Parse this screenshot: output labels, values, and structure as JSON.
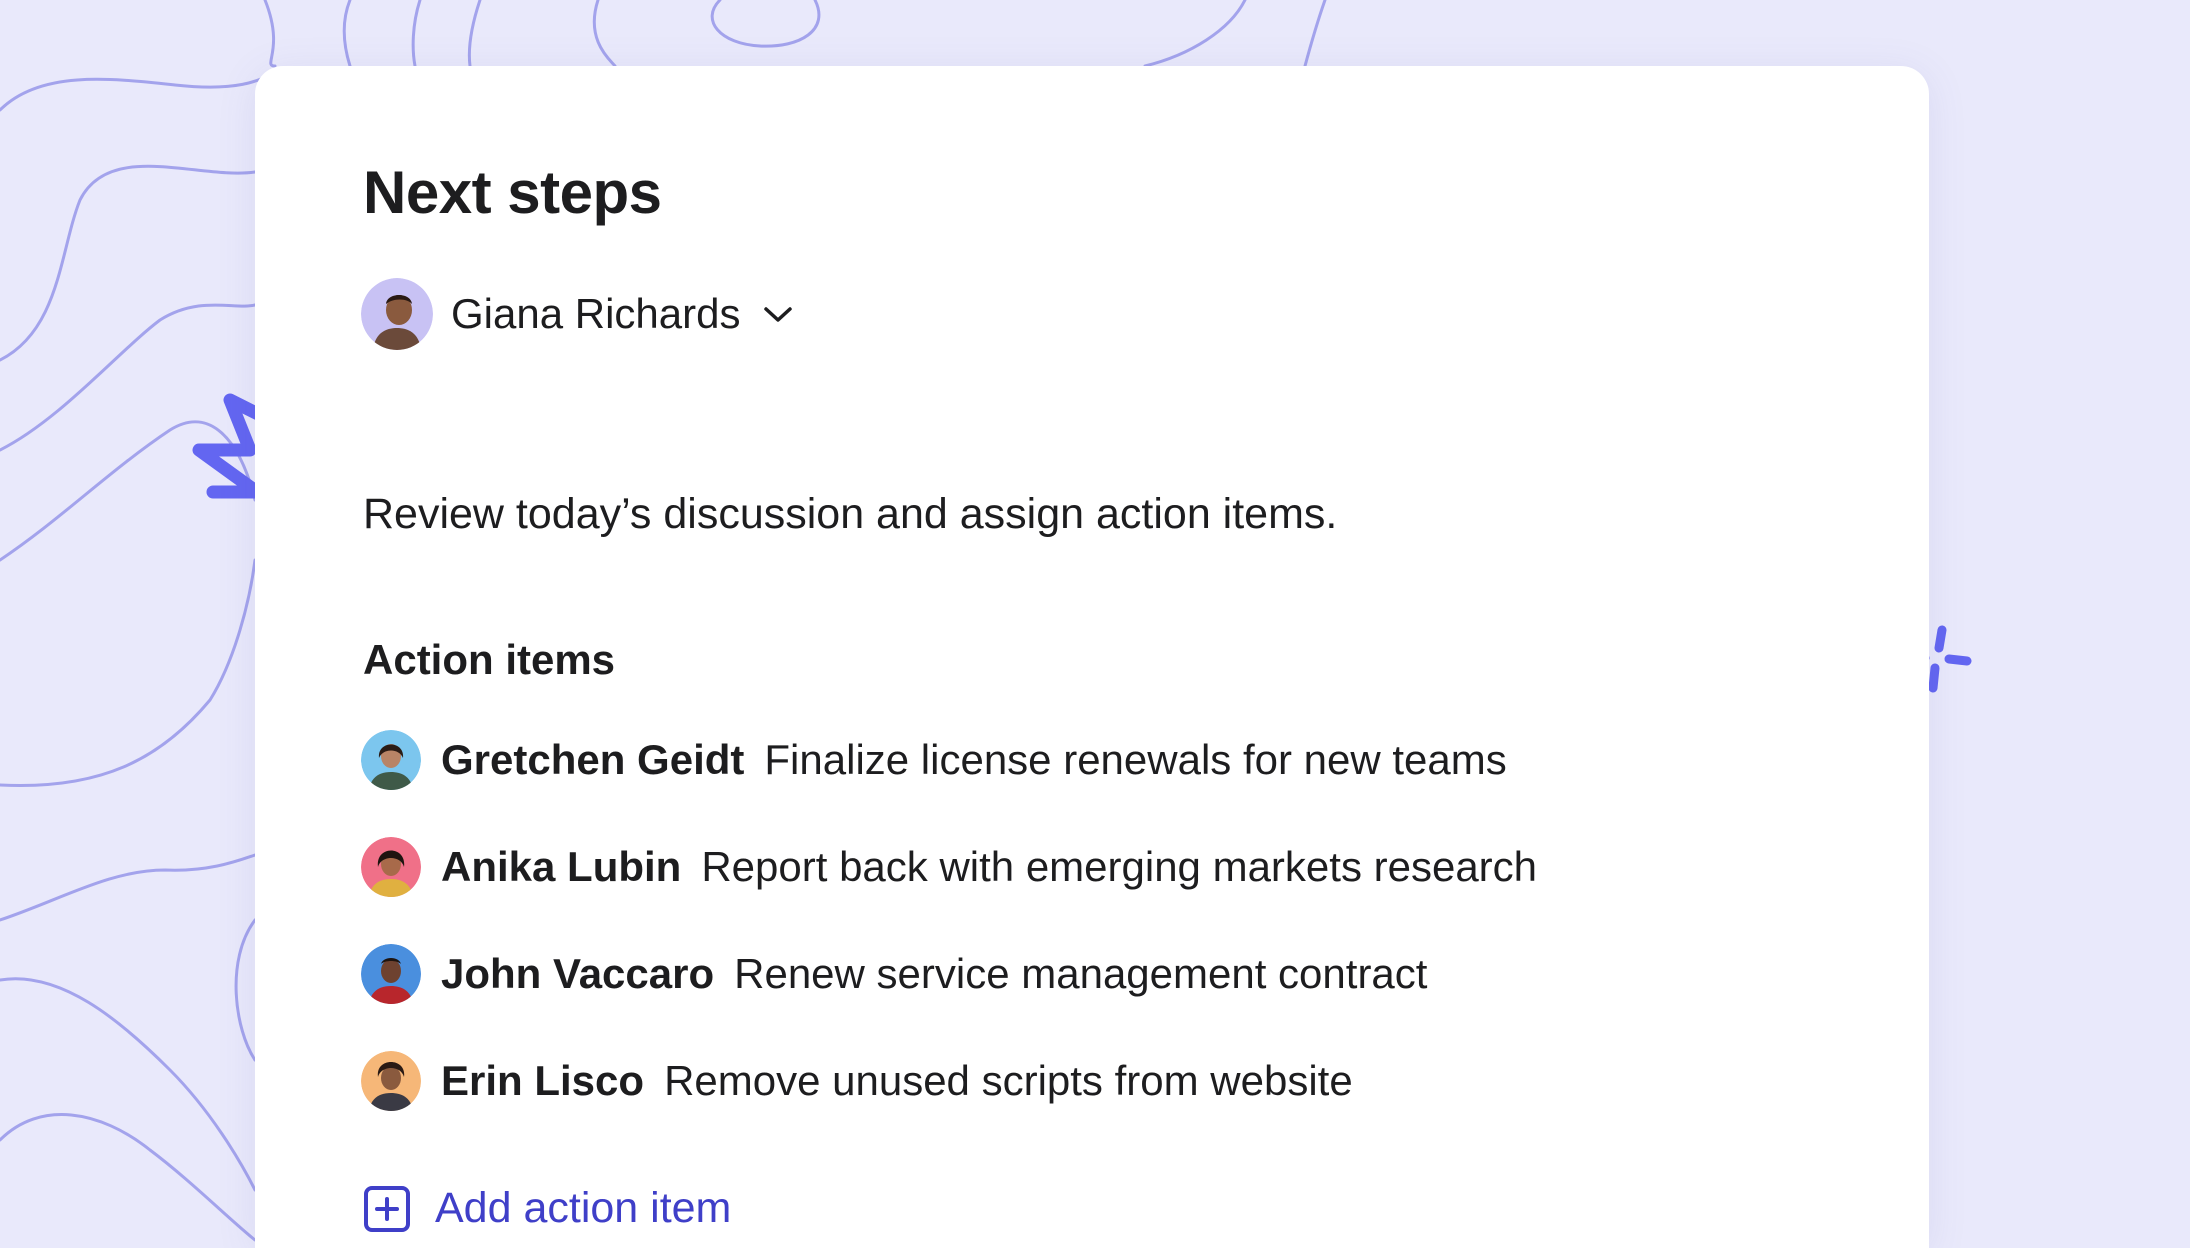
{
  "card": {
    "title": "Next steps",
    "owner": {
      "name": "Giana Richards",
      "avatar_bg": "#c8c2f4"
    },
    "description": "Review today’s discussion and assign action items.",
    "action_items_heading": "Action items",
    "action_items": [
      {
        "assignee": "Gretchen Geidt",
        "task": "Finalize license renewals for new teams",
        "avatar_bg": "#7cc6ee"
      },
      {
        "assignee": "Anika Lubin",
        "task": "Report back with emerging markets research",
        "avatar_bg": "#f07088"
      },
      {
        "assignee": "John Vaccaro",
        "task": "Renew service management contract",
        "avatar_bg": "#4a8fde"
      },
      {
        "assignee": "Erin Lisco",
        "task": "Remove unused scripts from website",
        "avatar_bg": "#f6b778"
      }
    ],
    "add_action_label": "Add action item"
  },
  "colors": {
    "background": "#e9e9fb",
    "accent": "#6366f1",
    "link": "#3f3fc8",
    "text": "#1d1d1f"
  }
}
